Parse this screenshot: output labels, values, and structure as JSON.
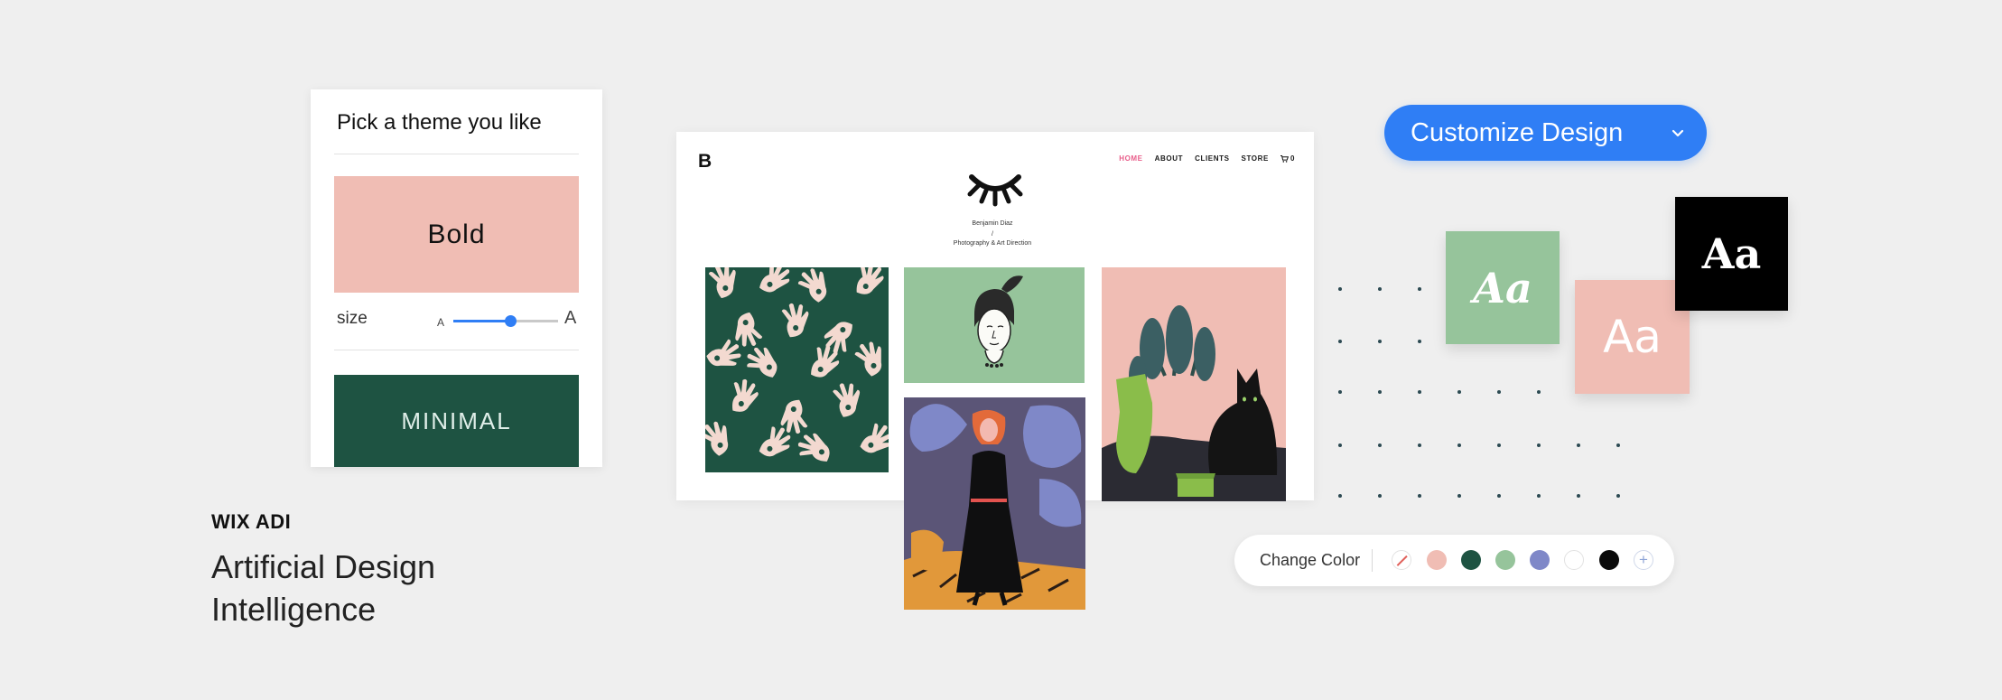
{
  "theme_panel": {
    "title": "Pick a theme you like",
    "bold_theme": "Bold",
    "size_label": "size",
    "size_small_glyph": "A",
    "size_large_glyph": "A",
    "size_value": 0.55,
    "minimal_theme": "MINIMAL"
  },
  "brand": {
    "name": "WIX ADI",
    "tagline": "Artificial Design Intelligence"
  },
  "site_preview": {
    "logo": "B",
    "nav": [
      "HOME",
      "ABOUT",
      "CLIENTS",
      "STORE"
    ],
    "cart_count": "0",
    "author": "Benjamin Diaz",
    "slash": "/",
    "subtitle": "Photography & Art Direction"
  },
  "customize": {
    "label": "Customize Design"
  },
  "font_cards": {
    "script": "Aa",
    "sans": "Aa",
    "serif": "Aa"
  },
  "color_bar": {
    "label": "Change Color",
    "swatches": [
      "#f0bdb4",
      "#1e5342",
      "#96c49b",
      "#7f88c8",
      "#ffffff",
      "#0b0b0b"
    ],
    "add_symbol": "+"
  },
  "colors": {
    "accent": "#2f7ef5",
    "pink": "#f0bdb4",
    "dark_green": "#1e5342",
    "light_green": "#96c49b",
    "nav_active": "#e85d8a"
  }
}
